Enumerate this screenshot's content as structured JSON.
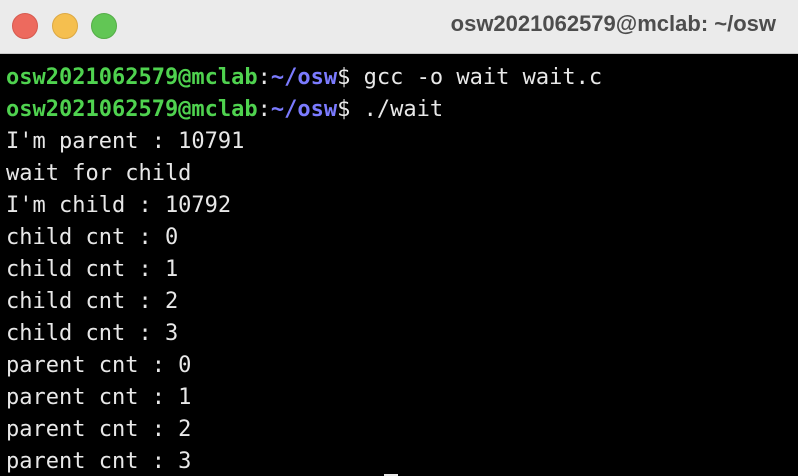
{
  "window": {
    "title": "osw2021062579@mclab: ~/osw"
  },
  "prompt": {
    "user_host": "osw2021062579@mclab",
    "colon": ":",
    "path": "~/osw",
    "dollar": "$"
  },
  "colors": {
    "prompt_user": "#4fd24f",
    "prompt_path": "#7b7bff",
    "text": "#e8e8e8",
    "background": "#000000"
  },
  "terminal": {
    "commands": [
      " gcc -o wait wait.c",
      " ./wait"
    ],
    "output": [
      "I'm parent : 10791",
      "wait for child",
      "I'm child : 10792",
      "child cnt : 0",
      "child cnt : 1",
      "child cnt : 2",
      "child cnt : 3",
      "parent cnt : 0",
      "parent cnt : 1",
      "parent cnt : 2",
      "parent cnt : 3"
    ]
  }
}
